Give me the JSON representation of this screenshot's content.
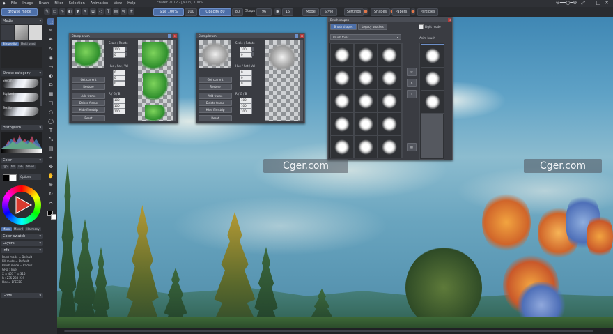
{
  "app": {
    "menu": [
      "File",
      "Image",
      "Brush",
      "Filter",
      "Selection",
      "Animation",
      "View",
      "Help"
    ],
    "title": "chafer 2012 - [Main] 100%"
  },
  "toolbar": {
    "browse_mode": "Browse mode",
    "size": "Size 100%",
    "size_value": "100",
    "opacity": "Opacity 80",
    "opacity_value": "80",
    "steps_label": "Steps",
    "steps_value": "96",
    "flow_value": "15",
    "mode": "Mode",
    "style": "Style",
    "settings": "Settings",
    "shapes": "Shapes",
    "papers": "Papers",
    "particles": "Particles"
  },
  "left_panel": {
    "media": "Media",
    "media_tabs": [
      "Simple list",
      "Multi used"
    ],
    "brushes_header": "Stroke category",
    "brush_names": [
      "Sketch",
      "Stylized",
      "Textile"
    ],
    "histogram": "Histogram",
    "color": "Color",
    "color_tabs": [
      "rgb",
      "hsl",
      "lab",
      "blend"
    ],
    "options": "Options",
    "mixer_tabs": [
      "Mixer",
      "Mixer2",
      "Harmony"
    ],
    "color_swatch": "Color swatch",
    "layers": "Layers",
    "info": "Info",
    "info_lines": [
      "Paint mode = Default",
      "Fill mode = Default",
      "Brush mode = Radius",
      "GPU : True",
      "X = 467  Y = 315",
      "R : 235  238  239",
      "Hex = EFEEEE"
    ],
    "grids": "Grids"
  },
  "brush_panel_1": {
    "title": "Stamp brush",
    "scale_rotate": "Scale / Rotate",
    "scale_value": "100",
    "rotate_value": "0",
    "hsv": "Hue / Sat / Val",
    "hsv_values": [
      "0",
      "0",
      "0"
    ],
    "get_current": "Get current",
    "restore": "Restore",
    "add_frame": "Add frame",
    "delete_frame": "Delete frame",
    "hide_filmstrip": "Hide filmstrip",
    "reset": "Reset",
    "rgb_label": "R / G / B",
    "rgb_values": [
      "100",
      "100",
      "100"
    ]
  },
  "brush_panel_2": {
    "title": "Stamp brush",
    "scale_rotate": "Scale / Rotate",
    "scale_value": "100",
    "rotate_value": "0",
    "hsv": "Hue / Sat / Val",
    "hsv_values": [
      "0",
      "0",
      "0"
    ],
    "get_current": "Get current",
    "restore": "Restore",
    "add_frame": "Add frame",
    "delete_frame": "Delete frame",
    "hide_filmstrip": "Hide filmstrip",
    "reset": "Reset",
    "rgb_label": "R / G / B",
    "rgb_values": [
      "100",
      "100",
      "100"
    ]
  },
  "shapes_panel": {
    "title": "Brush shapes",
    "tabs": [
      "Brush shapes",
      "Legacy brushes"
    ],
    "dropdown": "Brush tools",
    "light_mode": "Light mode",
    "anim_brush": "Anim brush"
  },
  "watermarks": [
    "Cger.com",
    "Cger.com"
  ]
}
